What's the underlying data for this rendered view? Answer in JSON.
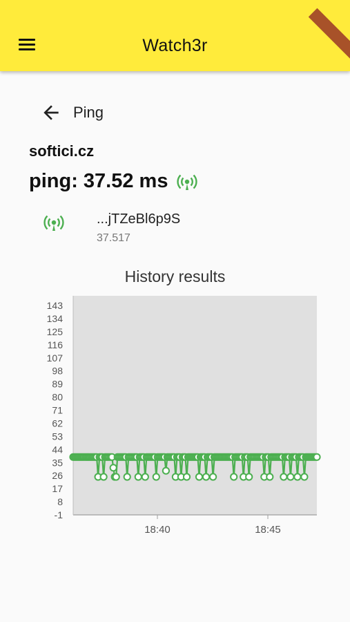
{
  "app": {
    "title": "Watch3r"
  },
  "nav": {
    "back_label": "Ping"
  },
  "detail": {
    "host": "softici.cz",
    "ping_text": "ping: 37.52 ms",
    "item_title": "...jTZeBl6p9S",
    "item_value": "37.517"
  },
  "chart_data": {
    "type": "line",
    "title": "History results",
    "xlabel": "",
    "ylabel": "",
    "y_ticks": [
      "143",
      "134",
      "125",
      "116",
      "107",
      "98",
      "89",
      "80",
      "71",
      "62",
      "53",
      "44",
      "35",
      "26",
      "17",
      "8",
      "-1"
    ],
    "ylim": [
      -1,
      143
    ],
    "x_ticks": [
      "18:40",
      "18:45"
    ],
    "grid": false,
    "series": [
      {
        "color": "#4caf50",
        "values": [
          37,
          37,
          37,
          37,
          37,
          37,
          37,
          37,
          37,
          37,
          37,
          37,
          37,
          37,
          37,
          37,
          37,
          37,
          24,
          37,
          37,
          37,
          24,
          37,
          37,
          37,
          37,
          37,
          37,
          30,
          24,
          24,
          37,
          37,
          37,
          37,
          37,
          37,
          37,
          24,
          37,
          37,
          37,
          37,
          37,
          37,
          37,
          24,
          37,
          37,
          37,
          37,
          24,
          37,
          37,
          37,
          37,
          37,
          37,
          37,
          24,
          37,
          37,
          37,
          37,
          37,
          37,
          28,
          37,
          37,
          37,
          37,
          37,
          37,
          24,
          37,
          37,
          37,
          24,
          37,
          37,
          37,
          24,
          37,
          37,
          37,
          37,
          37,
          37,
          37,
          37,
          24,
          37,
          37,
          37,
          37,
          24,
          37,
          37,
          37,
          37,
          24,
          37,
          37,
          37,
          37,
          37,
          37,
          37,
          37,
          37,
          37,
          37,
          37,
          37,
          37,
          24,
          37,
          37,
          37,
          37,
          37,
          37,
          24,
          37,
          37,
          37,
          24,
          37,
          37,
          37,
          37,
          37,
          37,
          37,
          37,
          37,
          37,
          24,
          37,
          37,
          37,
          24,
          37,
          37,
          37,
          37,
          37,
          37,
          37,
          37,
          37,
          24,
          37,
          37,
          37,
          37,
          24,
          37,
          37,
          37,
          37,
          24,
          37,
          37,
          37,
          37,
          24,
          37,
          37,
          37,
          37,
          37,
          37,
          37,
          37,
          37
        ]
      }
    ]
  },
  "colors": {
    "appbar": "#ffeb3b",
    "accent": "#4caf50",
    "plot_bg": "#e0e0e0"
  },
  "icons": {
    "menu": "menu-icon",
    "back": "arrow-back-icon",
    "status": "signal-broadcast-icon"
  }
}
